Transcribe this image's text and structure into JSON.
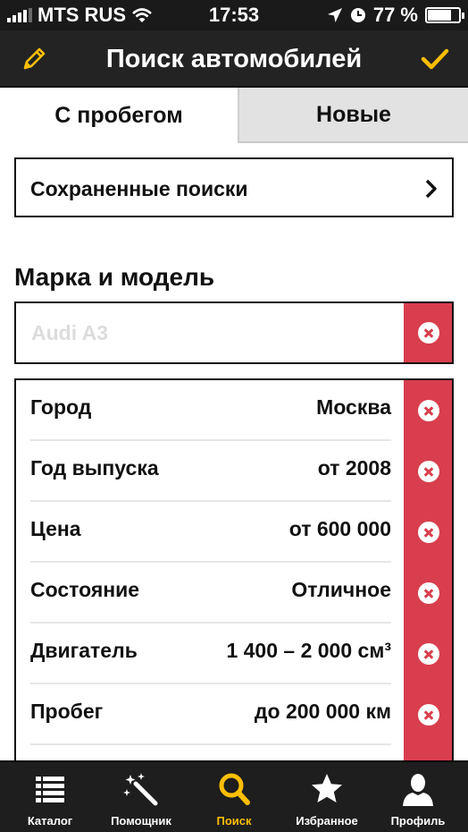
{
  "status_bar": {
    "carrier": "MTS RUS",
    "time": "17:53",
    "battery": "77 %",
    "battery_level": 0.77
  },
  "navbar": {
    "title": "Поиск автомобилей",
    "left_icon": "pencil-icon",
    "right_icon": "checkmark-icon"
  },
  "tabs": [
    {
      "label": "С пробегом",
      "active": true
    },
    {
      "label": "Новые",
      "active": false
    }
  ],
  "saved_searches": {
    "label": "Сохраненные поиски"
  },
  "make_model": {
    "title": "Марка и модель",
    "placeholder": "Audi A3"
  },
  "filters": [
    {
      "label": "Город",
      "value": "Москва"
    },
    {
      "label": "Год выпуска",
      "value": "от 2008"
    },
    {
      "label": "Цена",
      "value": "от 600 000"
    },
    {
      "label": "Состояние",
      "value": "Отличное"
    },
    {
      "label": "Двигатель",
      "value": "1 400 – 2 000 см³"
    },
    {
      "label": "Пробег",
      "value": "до 200 000 км"
    }
  ],
  "tab_bar": [
    {
      "label": "Каталог",
      "icon": "list-icon",
      "active": false
    },
    {
      "label": "Помощник",
      "icon": "magic-wand-icon",
      "active": false
    },
    {
      "label": "Поиск",
      "icon": "search-icon",
      "active": true
    },
    {
      "label": "Избранное",
      "icon": "star-icon",
      "active": false
    },
    {
      "label": "Профиль",
      "icon": "person-icon",
      "active": false
    }
  ],
  "colors": {
    "accent": "#ffbe00",
    "clear_button": "#d83e4d",
    "navbar": "#232323"
  }
}
